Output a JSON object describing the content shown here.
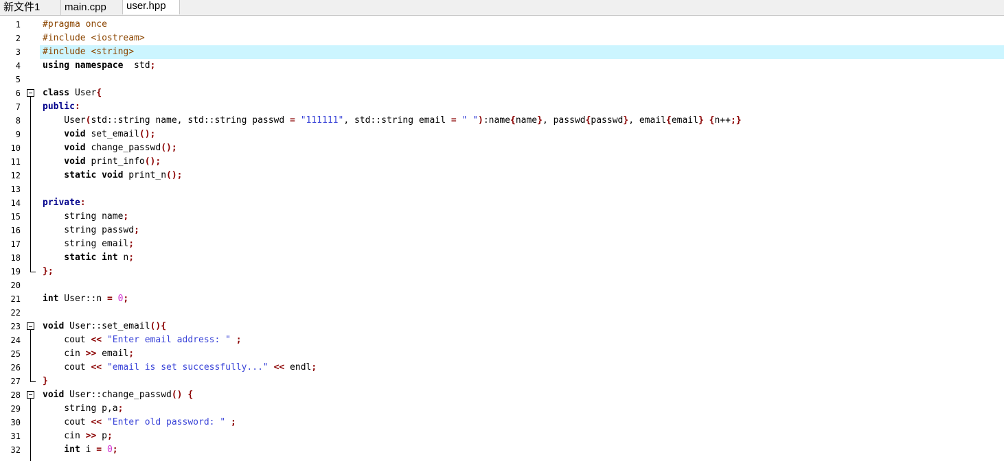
{
  "tabs": [
    "新文件1",
    "main.cpp",
    "user.hpp"
  ],
  "active_tab": 2,
  "highlighted_line": 3,
  "lines": [
    [
      [
        "pp",
        "#pragma once"
      ]
    ],
    [
      [
        "pp",
        "#include <iostream>"
      ]
    ],
    [
      [
        "pp",
        "#include <string>"
      ]
    ],
    [
      [
        "kw",
        "using namespace"
      ],
      [
        "",
        "  std"
      ],
      [
        "op",
        ";"
      ]
    ],
    [],
    [
      [
        "kw",
        "class"
      ],
      [
        "",
        " User"
      ],
      [
        "op",
        "{"
      ]
    ],
    [
      [
        "kb",
        "public"
      ],
      [
        "op",
        ":"
      ]
    ],
    [
      [
        "",
        "    User"
      ],
      [
        "op",
        "("
      ],
      [
        "",
        "std::string name, std::string passwd "
      ],
      [
        "op",
        "="
      ],
      [
        "",
        " "
      ],
      [
        "str",
        "\"111111\""
      ],
      [
        "",
        ", std::string email "
      ],
      [
        "op",
        "="
      ],
      [
        "",
        " "
      ],
      [
        "str",
        "\" \""
      ],
      [
        "op",
        ")"
      ],
      [
        "",
        ":name"
      ],
      [
        "op",
        "{"
      ],
      [
        "",
        "name"
      ],
      [
        "op",
        "}"
      ],
      [
        "",
        ", passwd"
      ],
      [
        "op",
        "{"
      ],
      [
        "",
        "passwd"
      ],
      [
        "op",
        "}"
      ],
      [
        "",
        ", email"
      ],
      [
        "op",
        "{"
      ],
      [
        "",
        "email"
      ],
      [
        "op",
        "}"
      ],
      [
        "",
        " "
      ],
      [
        "op",
        "{"
      ],
      [
        "",
        "n++"
      ],
      [
        "op",
        ";}"
      ]
    ],
    [
      [
        "kw",
        "    void"
      ],
      [
        "",
        " set_email"
      ],
      [
        "op",
        "();"
      ]
    ],
    [
      [
        "kw",
        "    void"
      ],
      [
        "",
        " change_passwd"
      ],
      [
        "op",
        "();"
      ]
    ],
    [
      [
        "kw",
        "    void"
      ],
      [
        "",
        " print_info"
      ],
      [
        "op",
        "();"
      ]
    ],
    [
      [
        "kw",
        "    static void"
      ],
      [
        "",
        " print_n"
      ],
      [
        "op",
        "();"
      ]
    ],
    [],
    [
      [
        "kb",
        "private"
      ],
      [
        "op",
        ":"
      ]
    ],
    [
      [
        "",
        "    string name"
      ],
      [
        "op",
        ";"
      ]
    ],
    [
      [
        "",
        "    string passwd"
      ],
      [
        "op",
        ";"
      ]
    ],
    [
      [
        "",
        "    string email"
      ],
      [
        "op",
        ";"
      ]
    ],
    [
      [
        "kw",
        "    static int"
      ],
      [
        "",
        " n"
      ],
      [
        "op",
        ";"
      ]
    ],
    [
      [
        "op",
        "};"
      ]
    ],
    [],
    [
      [
        "kw",
        "int"
      ],
      [
        "",
        " User::n "
      ],
      [
        "op",
        "="
      ],
      [
        "",
        " "
      ],
      [
        "num",
        "0"
      ],
      [
        "op",
        ";"
      ]
    ],
    [],
    [
      [
        "kw",
        "void"
      ],
      [
        "",
        " User::set_email"
      ],
      [
        "op",
        "(){"
      ]
    ],
    [
      [
        "",
        "    cout "
      ],
      [
        "op",
        "<<"
      ],
      [
        "",
        " "
      ],
      [
        "str",
        "\"Enter email address: \""
      ],
      [
        "",
        " "
      ],
      [
        "op",
        ";"
      ]
    ],
    [
      [
        "",
        "    cin "
      ],
      [
        "op",
        ">>"
      ],
      [
        "",
        " email"
      ],
      [
        "op",
        ";"
      ]
    ],
    [
      [
        "",
        "    cout "
      ],
      [
        "op",
        "<<"
      ],
      [
        "",
        " "
      ],
      [
        "str",
        "\"email is set successfully...\""
      ],
      [
        "",
        " "
      ],
      [
        "op",
        "<<"
      ],
      [
        "",
        " endl"
      ],
      [
        "op",
        ";"
      ]
    ],
    [
      [
        "op",
        "}"
      ]
    ],
    [
      [
        "kw",
        "void"
      ],
      [
        "",
        " User::change_passwd"
      ],
      [
        "op",
        "()"
      ],
      [
        "",
        " "
      ],
      [
        "op",
        "{"
      ]
    ],
    [
      [
        "",
        "    string p,a"
      ],
      [
        "op",
        ";"
      ]
    ],
    [
      [
        "",
        "    cout "
      ],
      [
        "op",
        "<<"
      ],
      [
        "",
        " "
      ],
      [
        "str",
        "\"Enter old password: \""
      ],
      [
        "",
        " "
      ],
      [
        "op",
        ";"
      ]
    ],
    [
      [
        "",
        "    cin "
      ],
      [
        "op",
        ">>"
      ],
      [
        "",
        " p"
      ],
      [
        "op",
        ";"
      ]
    ],
    [
      [
        "kw",
        "    int"
      ],
      [
        "",
        " i "
      ],
      [
        "op",
        "="
      ],
      [
        "",
        " "
      ],
      [
        "num",
        "0"
      ],
      [
        "op",
        ";"
      ]
    ]
  ]
}
